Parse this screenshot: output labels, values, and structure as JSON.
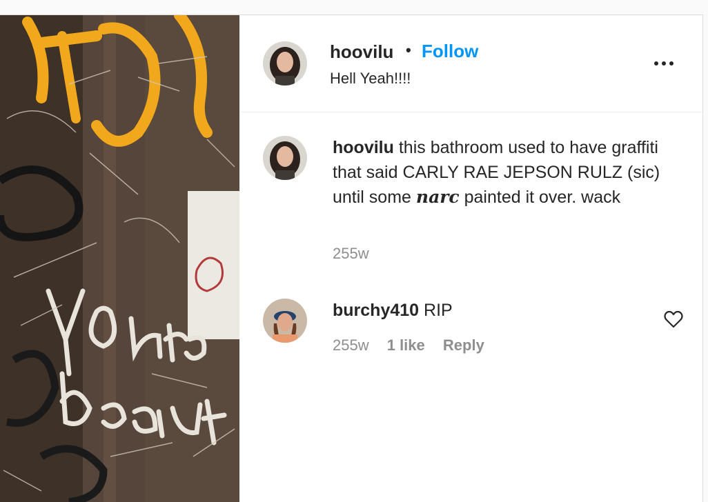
{
  "post": {
    "author": "hoovilu",
    "separator": "•",
    "follow_label": "Follow",
    "caption": "Hell Yeah!!!!",
    "more_icon": "more-horizontal-icon"
  },
  "comments": [
    {
      "username": "hoovilu",
      "text_before": "this bathroom used to have graffiti that said CARLY RAE JEPSON RULZ (sic) until some ",
      "text_styled": "narc",
      "text_after": " painted it over. wack",
      "age": "255w"
    },
    {
      "username": "burchy410",
      "text": "RIP",
      "age": "255w",
      "likes": "1 like",
      "reply_label": "Reply",
      "like_icon": "heart-icon"
    }
  ],
  "colors": {
    "follow": "#0095f6",
    "meta": "#8e8e8e",
    "text": "#262626"
  }
}
